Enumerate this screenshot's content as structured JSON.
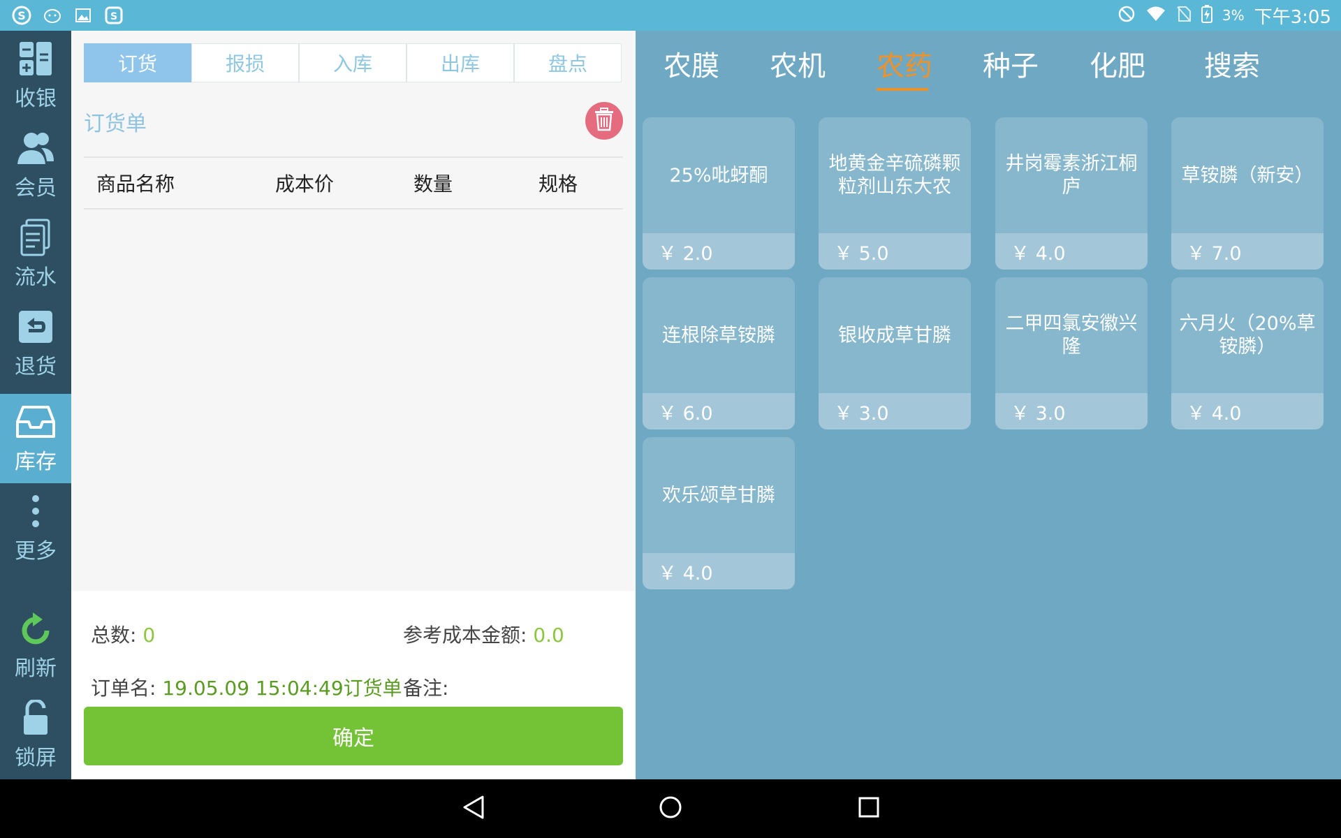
{
  "status_bar": {
    "battery": "3%",
    "time": "下午3:05",
    "left_icons": [
      "sogou-icon",
      "cat-icon",
      "image-icon",
      "app-icon"
    ],
    "right_icons": [
      "blocked-icon",
      "wifi-icon",
      "no-sim-icon",
      "battery-charging-icon"
    ]
  },
  "nav": {
    "items": [
      {
        "label": "收银",
        "icon": "cashier-icon",
        "active": false
      },
      {
        "label": "会员",
        "icon": "member-icon",
        "active": false
      },
      {
        "label": "流水",
        "icon": "ledger-icon",
        "active": false
      },
      {
        "label": "退货",
        "icon": "return-icon",
        "active": false
      },
      {
        "label": "库存",
        "icon": "inventory-icon",
        "active": true
      },
      {
        "label": "更多",
        "icon": "more-icon",
        "active": false
      },
      {
        "label": "刷新",
        "icon": "refresh-icon",
        "active": false
      },
      {
        "label": "锁屏",
        "icon": "lock-icon",
        "active": false
      }
    ]
  },
  "panel": {
    "tabs": [
      {
        "label": "订货",
        "active": true
      },
      {
        "label": "报损",
        "active": false
      },
      {
        "label": "入库",
        "active": false
      },
      {
        "label": "出库",
        "active": false
      },
      {
        "label": "盘点",
        "active": false
      }
    ],
    "title": "订货单",
    "columns": [
      "商品名称",
      "成本价",
      "数量",
      "规格"
    ],
    "footer": {
      "total_label": "总数:",
      "total_value": "0",
      "cost_label": "参考成本金额:",
      "cost_value": "0.0",
      "order_label": "订单名:",
      "order_value": "19.05.09 15:04:49订货单",
      "remark_label": "备注:",
      "remark_value": ""
    },
    "confirm_label": "确定"
  },
  "categories": [
    {
      "label": "农膜",
      "active": false
    },
    {
      "label": "农机",
      "active": false
    },
    {
      "label": "农药",
      "active": true
    },
    {
      "label": "种子",
      "active": false
    },
    {
      "label": "化肥",
      "active": false
    },
    {
      "label": "搜索",
      "active": false
    }
  ],
  "products": [
    {
      "name": "25%吡蚜酮",
      "price": "￥ 2.0"
    },
    {
      "name": "地黄金辛硫磷颗粒剂山东大农",
      "price": "￥ 5.0"
    },
    {
      "name": "井岗霉素浙江桐庐",
      "price": "￥ 4.0"
    },
    {
      "name": "草铵膦（新安）",
      "price": "￥ 7.0"
    },
    {
      "name": "连根除草铵膦",
      "price": "￥ 6.0"
    },
    {
      "name": "银收成草甘膦",
      "price": "￥ 3.0"
    },
    {
      "name": "二甲四氯安徽兴隆",
      "price": "￥ 3.0"
    },
    {
      "name": "六月火（20%草铵膦）",
      "price": "￥ 4.0"
    },
    {
      "name": "欢乐颂草甘膦",
      "price": "￥ 4.0"
    }
  ],
  "colors": {
    "accent_green": "#74c235",
    "accent_orange": "#f0922a",
    "nav_bg": "#2e4e61",
    "status_bar": "#5bb7d6"
  }
}
